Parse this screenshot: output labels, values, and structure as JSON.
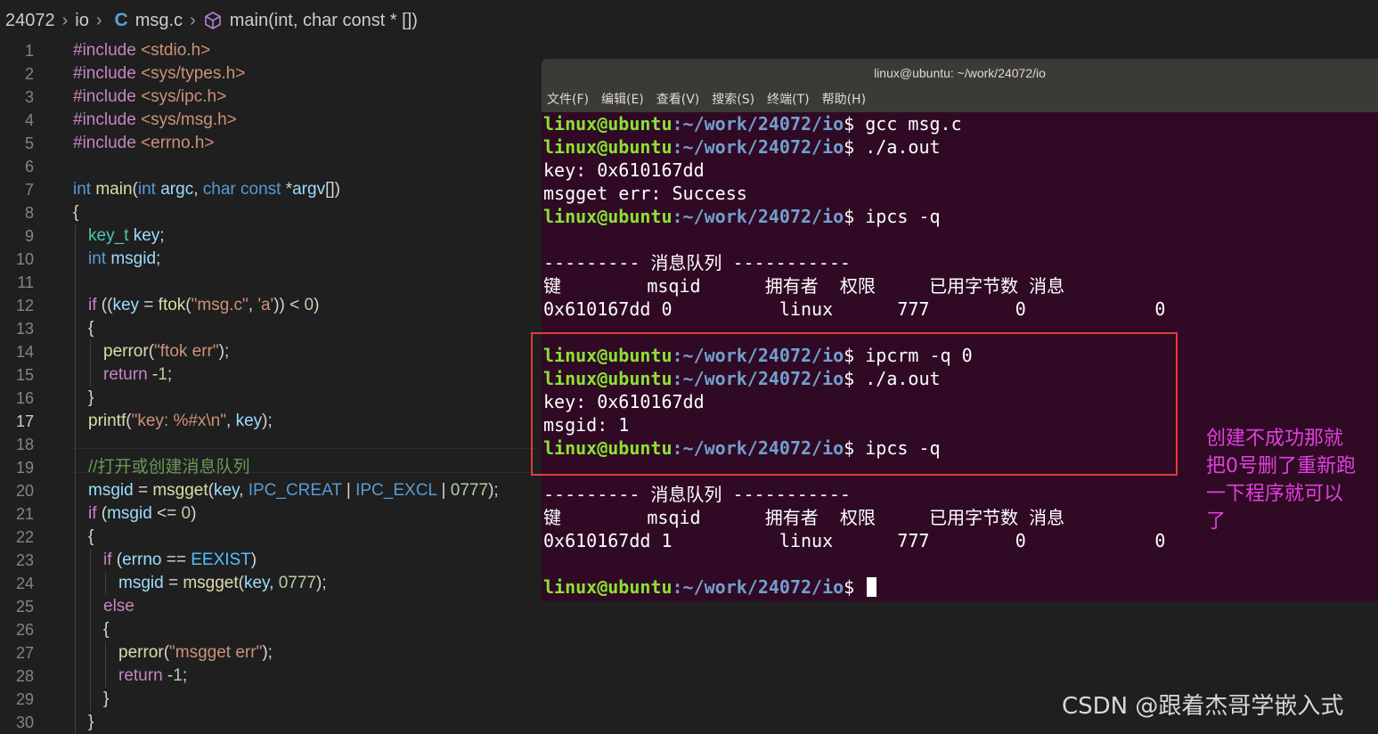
{
  "breadcrumb": {
    "folder": "24072",
    "subfolder": "io",
    "file_icon": "C",
    "file": "msg.c",
    "symbol": "main(int, char const * [])"
  },
  "editor": {
    "active_line": 17,
    "lines": [
      {
        "n": 1,
        "indent": 0,
        "tokens": [
          {
            "c": "pp",
            "t": "#include "
          },
          {
            "c": "str",
            "t": "<stdio.h>"
          }
        ]
      },
      {
        "n": 2,
        "indent": 0,
        "tokens": [
          {
            "c": "pp",
            "t": "#include "
          },
          {
            "c": "str",
            "t": "<sys/types.h>"
          }
        ]
      },
      {
        "n": 3,
        "indent": 0,
        "tokens": [
          {
            "c": "pp",
            "t": "#include "
          },
          {
            "c": "str",
            "t": "<sys/ipc.h>"
          }
        ]
      },
      {
        "n": 4,
        "indent": 0,
        "tokens": [
          {
            "c": "pp",
            "t": "#include "
          },
          {
            "c": "str",
            "t": "<sys/msg.h>"
          }
        ]
      },
      {
        "n": 5,
        "indent": 0,
        "tokens": [
          {
            "c": "pp",
            "t": "#include "
          },
          {
            "c": "str",
            "t": "<errno.h>"
          }
        ]
      },
      {
        "n": 6,
        "indent": 0,
        "tokens": []
      },
      {
        "n": 7,
        "indent": 0,
        "tokens": [
          {
            "c": "kw",
            "t": "int "
          },
          {
            "c": "fn",
            "t": "main"
          },
          {
            "c": "p",
            "t": "("
          },
          {
            "c": "kw",
            "t": "int "
          },
          {
            "c": "var",
            "t": "argc"
          },
          {
            "c": "p",
            "t": ", "
          },
          {
            "c": "kw",
            "t": "char const "
          },
          {
            "c": "p",
            "t": "*"
          },
          {
            "c": "var",
            "t": "argv"
          },
          {
            "c": "p",
            "t": "[])"
          }
        ]
      },
      {
        "n": 8,
        "indent": 0,
        "tokens": [
          {
            "c": "p",
            "t": "{"
          }
        ]
      },
      {
        "n": 9,
        "indent": 1,
        "tokens": [
          {
            "c": "ty",
            "t": "key_t "
          },
          {
            "c": "var",
            "t": "key"
          },
          {
            "c": "p",
            "t": ";"
          }
        ]
      },
      {
        "n": 10,
        "indent": 1,
        "tokens": [
          {
            "c": "kw",
            "t": "int "
          },
          {
            "c": "var",
            "t": "msgid"
          },
          {
            "c": "p",
            "t": ";"
          }
        ]
      },
      {
        "n": 11,
        "indent": 1,
        "tokens": []
      },
      {
        "n": 12,
        "indent": 1,
        "tokens": [
          {
            "c": "ctl",
            "t": "if "
          },
          {
            "c": "p",
            "t": "(("
          },
          {
            "c": "var",
            "t": "key"
          },
          {
            "c": "p",
            "t": " = "
          },
          {
            "c": "fn",
            "t": "ftok"
          },
          {
            "c": "p",
            "t": "("
          },
          {
            "c": "str",
            "t": "\"msg.c\""
          },
          {
            "c": "p",
            "t": ", "
          },
          {
            "c": "str",
            "t": "'a'"
          },
          {
            "c": "p",
            "t": ")) < "
          },
          {
            "c": "num",
            "t": "0"
          },
          {
            "c": "p",
            "t": ")"
          }
        ]
      },
      {
        "n": 13,
        "indent": 1,
        "tokens": [
          {
            "c": "p",
            "t": "{"
          }
        ]
      },
      {
        "n": 14,
        "indent": 2,
        "tokens": [
          {
            "c": "fn",
            "t": "perror"
          },
          {
            "c": "p",
            "t": "("
          },
          {
            "c": "str",
            "t": "\"ftok err\""
          },
          {
            "c": "p",
            "t": ");"
          }
        ]
      },
      {
        "n": 15,
        "indent": 2,
        "tokens": [
          {
            "c": "ctl",
            "t": "return "
          },
          {
            "c": "p",
            "t": "-"
          },
          {
            "c": "num",
            "t": "1"
          },
          {
            "c": "p",
            "t": ";"
          }
        ]
      },
      {
        "n": 16,
        "indent": 1,
        "tokens": [
          {
            "c": "p",
            "t": "}"
          }
        ]
      },
      {
        "n": 17,
        "indent": 1,
        "tokens": [
          {
            "c": "fn",
            "t": "printf"
          },
          {
            "c": "p",
            "t": "("
          },
          {
            "c": "str",
            "t": "\"key: %#x\\n\""
          },
          {
            "c": "p",
            "t": ", "
          },
          {
            "c": "var",
            "t": "key"
          },
          {
            "c": "p",
            "t": ");"
          }
        ]
      },
      {
        "n": 18,
        "indent": 1,
        "tokens": []
      },
      {
        "n": 19,
        "indent": 1,
        "tokens": [
          {
            "c": "cm",
            "t": "//打开或创建消息队列"
          }
        ]
      },
      {
        "n": 20,
        "indent": 1,
        "tokens": [
          {
            "c": "var",
            "t": "msgid"
          },
          {
            "c": "p",
            "t": " = "
          },
          {
            "c": "fn",
            "t": "msgget"
          },
          {
            "c": "p",
            "t": "("
          },
          {
            "c": "var",
            "t": "key"
          },
          {
            "c": "p",
            "t": ", "
          },
          {
            "c": "kw",
            "t": "IPC_CREAT"
          },
          {
            "c": "p",
            "t": " | "
          },
          {
            "c": "kw",
            "t": "IPC_EXCL"
          },
          {
            "c": "p",
            "t": " | "
          },
          {
            "c": "num",
            "t": "0777"
          },
          {
            "c": "p",
            "t": ");"
          }
        ]
      },
      {
        "n": 21,
        "indent": 1,
        "tokens": [
          {
            "c": "ctl",
            "t": "if "
          },
          {
            "c": "p",
            "t": "("
          },
          {
            "c": "var",
            "t": "msgid"
          },
          {
            "c": "p",
            "t": " <= "
          },
          {
            "c": "num",
            "t": "0"
          },
          {
            "c": "p",
            "t": ")"
          }
        ]
      },
      {
        "n": 22,
        "indent": 1,
        "tokens": [
          {
            "c": "p",
            "t": "{"
          }
        ]
      },
      {
        "n": 23,
        "indent": 2,
        "tokens": [
          {
            "c": "ctl",
            "t": "if "
          },
          {
            "c": "p",
            "t": "("
          },
          {
            "c": "var",
            "t": "errno"
          },
          {
            "c": "p",
            "t": " == "
          },
          {
            "c": "cn",
            "t": "EEXIST"
          },
          {
            "c": "p",
            "t": ")"
          }
        ]
      },
      {
        "n": 24,
        "indent": 3,
        "tokens": [
          {
            "c": "var",
            "t": "msgid"
          },
          {
            "c": "p",
            "t": " = "
          },
          {
            "c": "fn",
            "t": "msgget"
          },
          {
            "c": "p",
            "t": "("
          },
          {
            "c": "var",
            "t": "key"
          },
          {
            "c": "p",
            "t": ", "
          },
          {
            "c": "num",
            "t": "0777"
          },
          {
            "c": "p",
            "t": ");"
          }
        ]
      },
      {
        "n": 25,
        "indent": 2,
        "tokens": [
          {
            "c": "ctl",
            "t": "else"
          }
        ]
      },
      {
        "n": 26,
        "indent": 2,
        "tokens": [
          {
            "c": "p",
            "t": "{"
          }
        ]
      },
      {
        "n": 27,
        "indent": 3,
        "tokens": [
          {
            "c": "fn",
            "t": "perror"
          },
          {
            "c": "p",
            "t": "("
          },
          {
            "c": "str",
            "t": "\"msgget err\""
          },
          {
            "c": "p",
            "t": ");"
          }
        ]
      },
      {
        "n": 28,
        "indent": 3,
        "tokens": [
          {
            "c": "ctl",
            "t": "return "
          },
          {
            "c": "p",
            "t": "-"
          },
          {
            "c": "num",
            "t": "1"
          },
          {
            "c": "p",
            "t": ";"
          }
        ]
      },
      {
        "n": 29,
        "indent": 2,
        "tokens": [
          {
            "c": "p",
            "t": "}"
          }
        ]
      },
      {
        "n": 30,
        "indent": 1,
        "tokens": [
          {
            "c": "p",
            "t": "}"
          }
        ]
      }
    ]
  },
  "terminal": {
    "title": "linux@ubuntu: ~/work/24072/io",
    "menu": [
      "文件(F)",
      "编辑(E)",
      "查看(V)",
      "搜索(S)",
      "终端(T)",
      "帮助(H)"
    ],
    "user": "linux@ubuntu",
    "path": ":~/work/24072/io",
    "prompt_suffix": "$ ",
    "lines": [
      {
        "type": "cmd",
        "text": "gcc msg.c"
      },
      {
        "type": "cmd",
        "text": "./a.out"
      },
      {
        "type": "out",
        "text": "key: 0x610167dd"
      },
      {
        "type": "out",
        "text": "msgget err: Success"
      },
      {
        "type": "cmd",
        "text": "ipcs -q"
      },
      {
        "type": "out",
        "text": ""
      },
      {
        "type": "out",
        "text": "--------- 消息队列 -----------"
      },
      {
        "type": "out",
        "text": "键        msqid      拥有者  权限     已用字节数 消息"
      },
      {
        "type": "out",
        "text": "0x610167dd 0          linux      777        0            0"
      },
      {
        "type": "out",
        "text": ""
      },
      {
        "type": "cmd",
        "text": "ipcrm -q 0"
      },
      {
        "type": "cmd",
        "text": "./a.out"
      },
      {
        "type": "out",
        "text": "key: 0x610167dd"
      },
      {
        "type": "out",
        "text": "msgid: 1"
      },
      {
        "type": "cmd",
        "text": "ipcs -q"
      },
      {
        "type": "out",
        "text": ""
      },
      {
        "type": "out",
        "text": "--------- 消息队列 -----------"
      },
      {
        "type": "out",
        "text": "键        msqid      拥有者  权限     已用字节数 消息"
      },
      {
        "type": "out",
        "text": "0x610167dd 1          linux      777        0            0"
      },
      {
        "type": "out",
        "text": ""
      },
      {
        "type": "cmd_cursor",
        "text": ""
      }
    ]
  },
  "annotation": {
    "lines": [
      "创建不成功那就",
      "把0号删了重新跑",
      "一下程序就可以",
      "了"
    ],
    "color": "#e040e0"
  },
  "watermark": "CSDN @跟着杰哥学嵌入式",
  "colors": {
    "prompt_user": "#8ae234",
    "prompt_path": "#729fcf",
    "terminal_bg": "#300a24",
    "highlight_box": "#e03c3c"
  }
}
